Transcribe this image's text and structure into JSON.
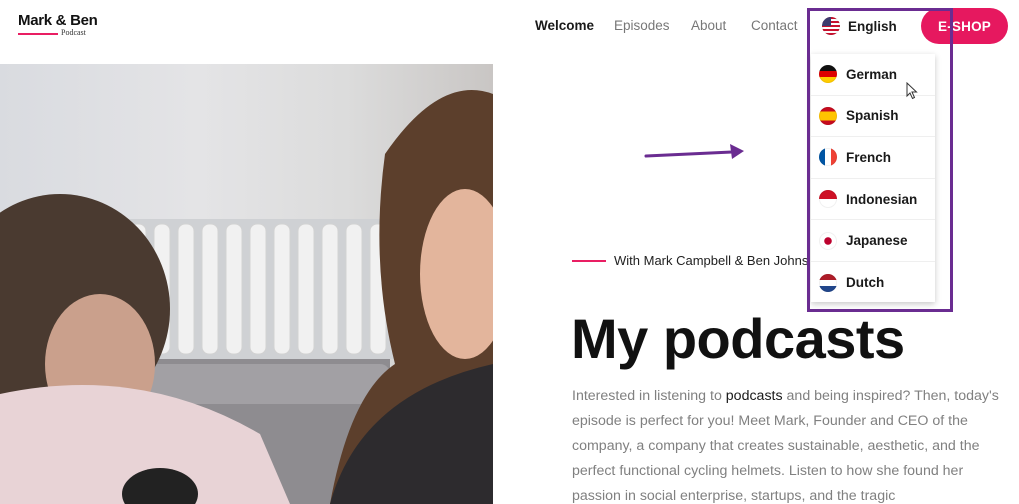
{
  "header": {
    "logo": {
      "title": "Mark & Ben",
      "subtitle": "Podcast"
    },
    "nav": [
      {
        "label": "Welcome"
      },
      {
        "label": "Episodes"
      },
      {
        "label": "About"
      },
      {
        "label": "Contact"
      }
    ],
    "language": {
      "current": "English",
      "flag": "us-flag-icon"
    },
    "eshop_label": "E-SHOP"
  },
  "language_dropdown": {
    "items": [
      {
        "label": "German",
        "flag": "germany-flag-icon"
      },
      {
        "label": "Spanish",
        "flag": "spain-flag-icon"
      },
      {
        "label": "French",
        "flag": "france-flag-icon"
      },
      {
        "label": "Indonesian",
        "flag": "indonesia-flag-icon"
      },
      {
        "label": "Japanese",
        "flag": "japan-flag-icon"
      },
      {
        "label": "Dutch",
        "flag": "netherlands-flag-icon"
      }
    ]
  },
  "hero": {
    "byline": "With Mark Campbell & Ben Johnson",
    "title": "My podcasts",
    "paragraph": {
      "before": "Interested in listening to ",
      "highlight": "podcasts",
      "after": " and being inspired? Then, today's episode is perfect for you! Meet Mark, Founder and CEO of the company, a company that creates sustainable, aesthetic, and the perfect functional cycling helmets. Listen to how she found her passion in social enterprise, startups, and the tragic"
    }
  },
  "colors": {
    "accent": "#e6185f",
    "annotation": "#6a2c91"
  }
}
